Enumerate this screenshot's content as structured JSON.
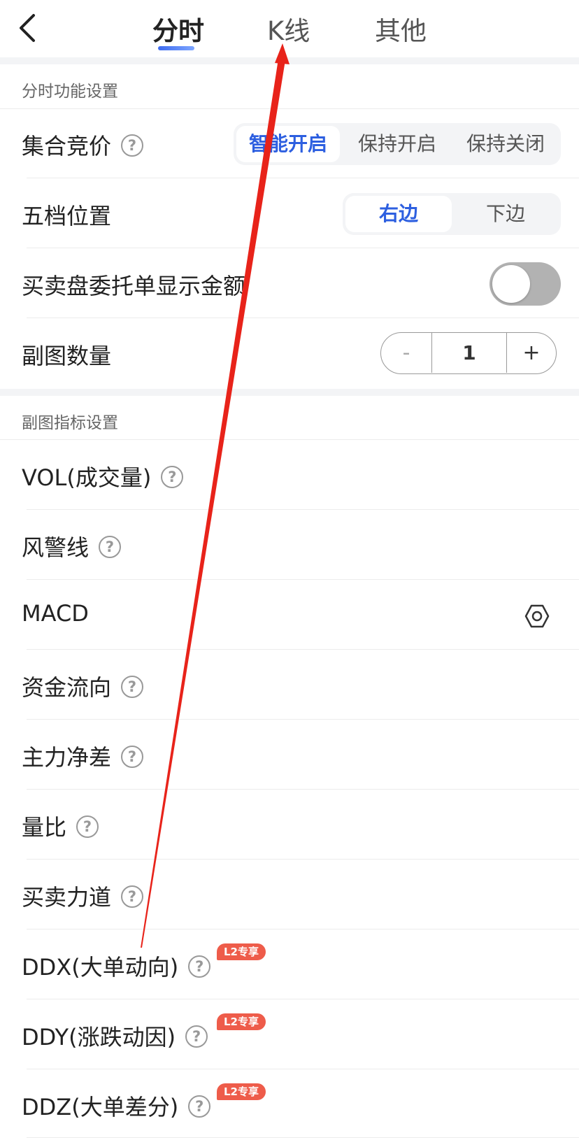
{
  "header": {
    "tabs": [
      {
        "label": "分时",
        "active": true
      },
      {
        "label": "K线",
        "active": false
      },
      {
        "label": "其他",
        "active": false
      }
    ]
  },
  "section1": {
    "title": "分时功能设置",
    "auction": {
      "label": "集合竞价",
      "options": [
        "智能开启",
        "保持开启",
        "保持关闭"
      ],
      "selected": "智能开启"
    },
    "level5_position": {
      "label": "五档位置",
      "options": [
        "右边",
        "下边"
      ],
      "selected": "右边"
    },
    "show_amount": {
      "label": "买卖盘委托单显示金额",
      "on": false
    },
    "sub_chart_count": {
      "label": "副图数量",
      "minus": "-",
      "value": "1",
      "plus": "+"
    }
  },
  "section2": {
    "title": "副图指标设置",
    "items": [
      {
        "label": "VOL(成交量)",
        "help": true
      },
      {
        "label": "风警线",
        "help": true
      },
      {
        "label": "MACD",
        "help": false,
        "settings": true
      },
      {
        "label": "资金流向",
        "help": true
      },
      {
        "label": "主力净差",
        "help": true
      },
      {
        "label": "量比",
        "help": true
      },
      {
        "label": "买卖力道",
        "help": true
      },
      {
        "label": "DDX(大单动向)",
        "help": true,
        "badge": "L2专享"
      },
      {
        "label": "DDY(涨跌动因)",
        "help": true,
        "badge": "L2专享"
      },
      {
        "label": "DDZ(大单差分)",
        "help": true,
        "badge": "L2专享"
      }
    ]
  },
  "help_glyph": "?",
  "colors": {
    "accent": "#2d5fe0",
    "badge": "#ee5c4a",
    "annotation_arrow": "#e8231a",
    "toggle_off": "#b2b2b2"
  },
  "icons": [
    "back-chevron-icon",
    "help-icon",
    "settings-hexagon-icon"
  ]
}
